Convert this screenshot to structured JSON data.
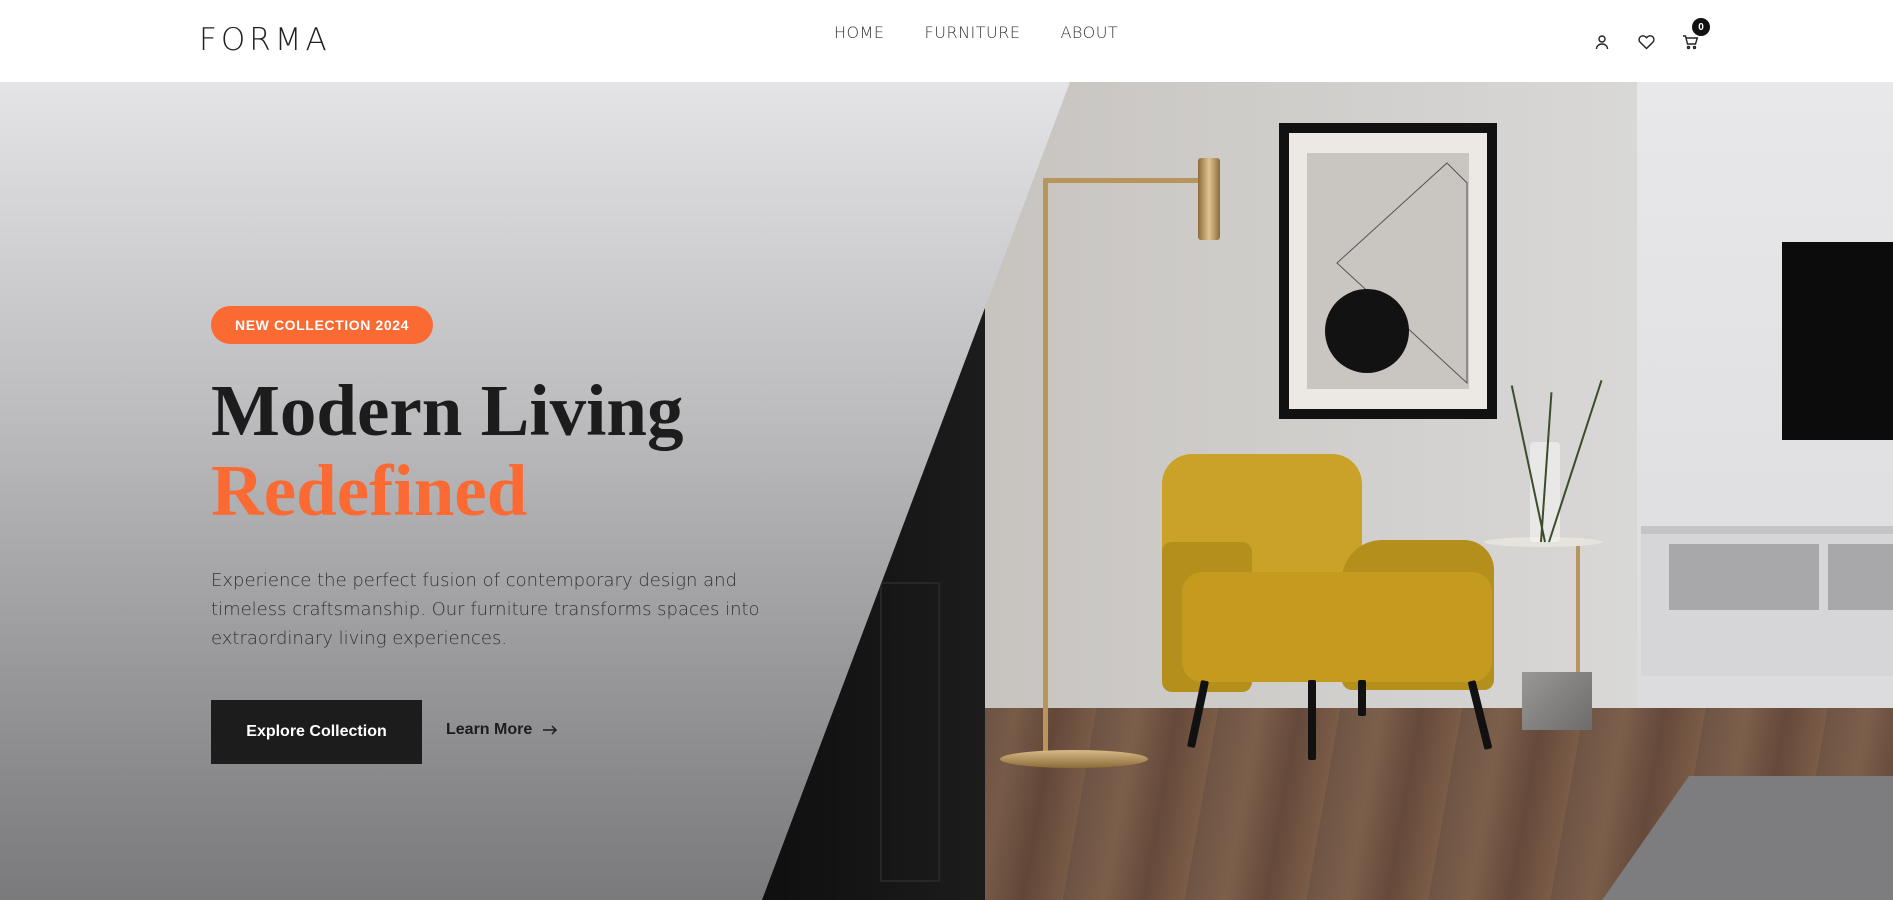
{
  "header": {
    "logo": "FORMA",
    "nav": [
      {
        "label": "HOME"
      },
      {
        "label": "FURNITURE"
      },
      {
        "label": "ABOUT"
      }
    ],
    "icons": {
      "account": "user-icon",
      "wishlist": "heart-icon",
      "cart": "cart-icon"
    },
    "cart_count": "0"
  },
  "hero": {
    "badge": "NEW COLLECTION 2024",
    "title_line1": "Modern Living",
    "title_line2": "Redefined",
    "description": "Experience the perfect fusion of contemporary design and timeless craftsmanship. Our furniture transforms spaces into extraordinary living experiences.",
    "primary_button": "Explore Collection",
    "secondary_button": "Learn More",
    "secondary_icon": "arrow-right-icon",
    "image": "living-room-with-yellow-armchair"
  },
  "colors": {
    "accent": "#fb6a32",
    "dark": "#1c1c1c",
    "chair": "#c9a227"
  }
}
